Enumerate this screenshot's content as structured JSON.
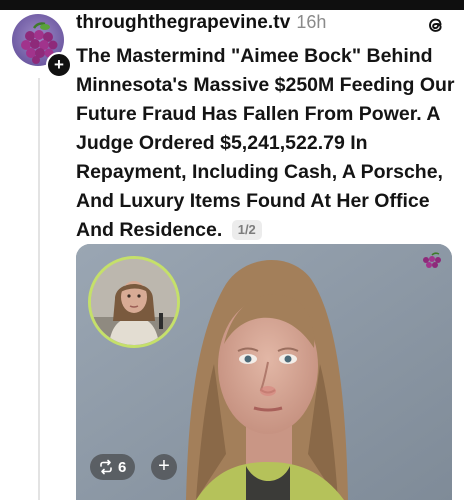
{
  "post": {
    "username": "throughthegrapevine.tv",
    "time_ago": "16h",
    "text": "The Mastermind \"Aimee Bock\" Behind Minnesota's Massive $250M Feeding Our Future Fraud Has Fallen From Power. A Judge Ordered $5,241,522.79 In Repayment, Including Cash, A Porsche, And Luxury Items Found At Her Office And Residence.",
    "page_indicator": "1/2"
  },
  "avatar": {
    "icon": "grapes-logo-icon",
    "follow_badge": "+"
  },
  "media": {
    "repost_count": "6",
    "repost_icon": "repost-icon",
    "add_label": "+",
    "inset_border_color": "#c5e06a",
    "watermark_icon": "grapes-logo-icon"
  },
  "colors": {
    "text": "#141414",
    "muted": "#8a8a8a",
    "header_bar": "#0f0f0f"
  }
}
